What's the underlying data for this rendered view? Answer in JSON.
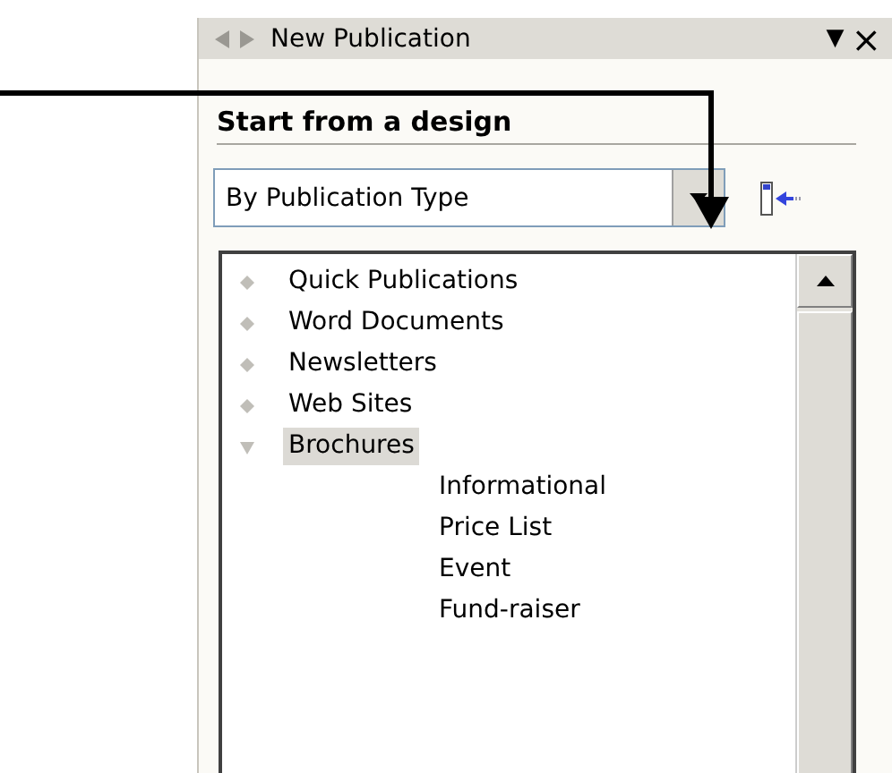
{
  "pane": {
    "title": "New Publication",
    "menu_glyph": "▼",
    "close_glyph": "×"
  },
  "section": {
    "heading": "Start from a design"
  },
  "dropdown": {
    "value": "By Publication Type"
  },
  "tree": [
    {
      "label": "Quick Publications",
      "expanded": false,
      "selected": false
    },
    {
      "label": "Word Documents",
      "expanded": false,
      "selected": false
    },
    {
      "label": "Newsletters",
      "expanded": false,
      "selected": false
    },
    {
      "label": "Web Sites",
      "expanded": false,
      "selected": false
    },
    {
      "label": "Brochures",
      "expanded": true,
      "selected": true,
      "children": [
        {
          "label": "Informational",
          "selected": false
        },
        {
          "label": "Price List",
          "selected": false
        },
        {
          "label": "Event",
          "selected": false
        },
        {
          "label": "Fund-raiser",
          "selected": false
        }
      ]
    }
  ]
}
